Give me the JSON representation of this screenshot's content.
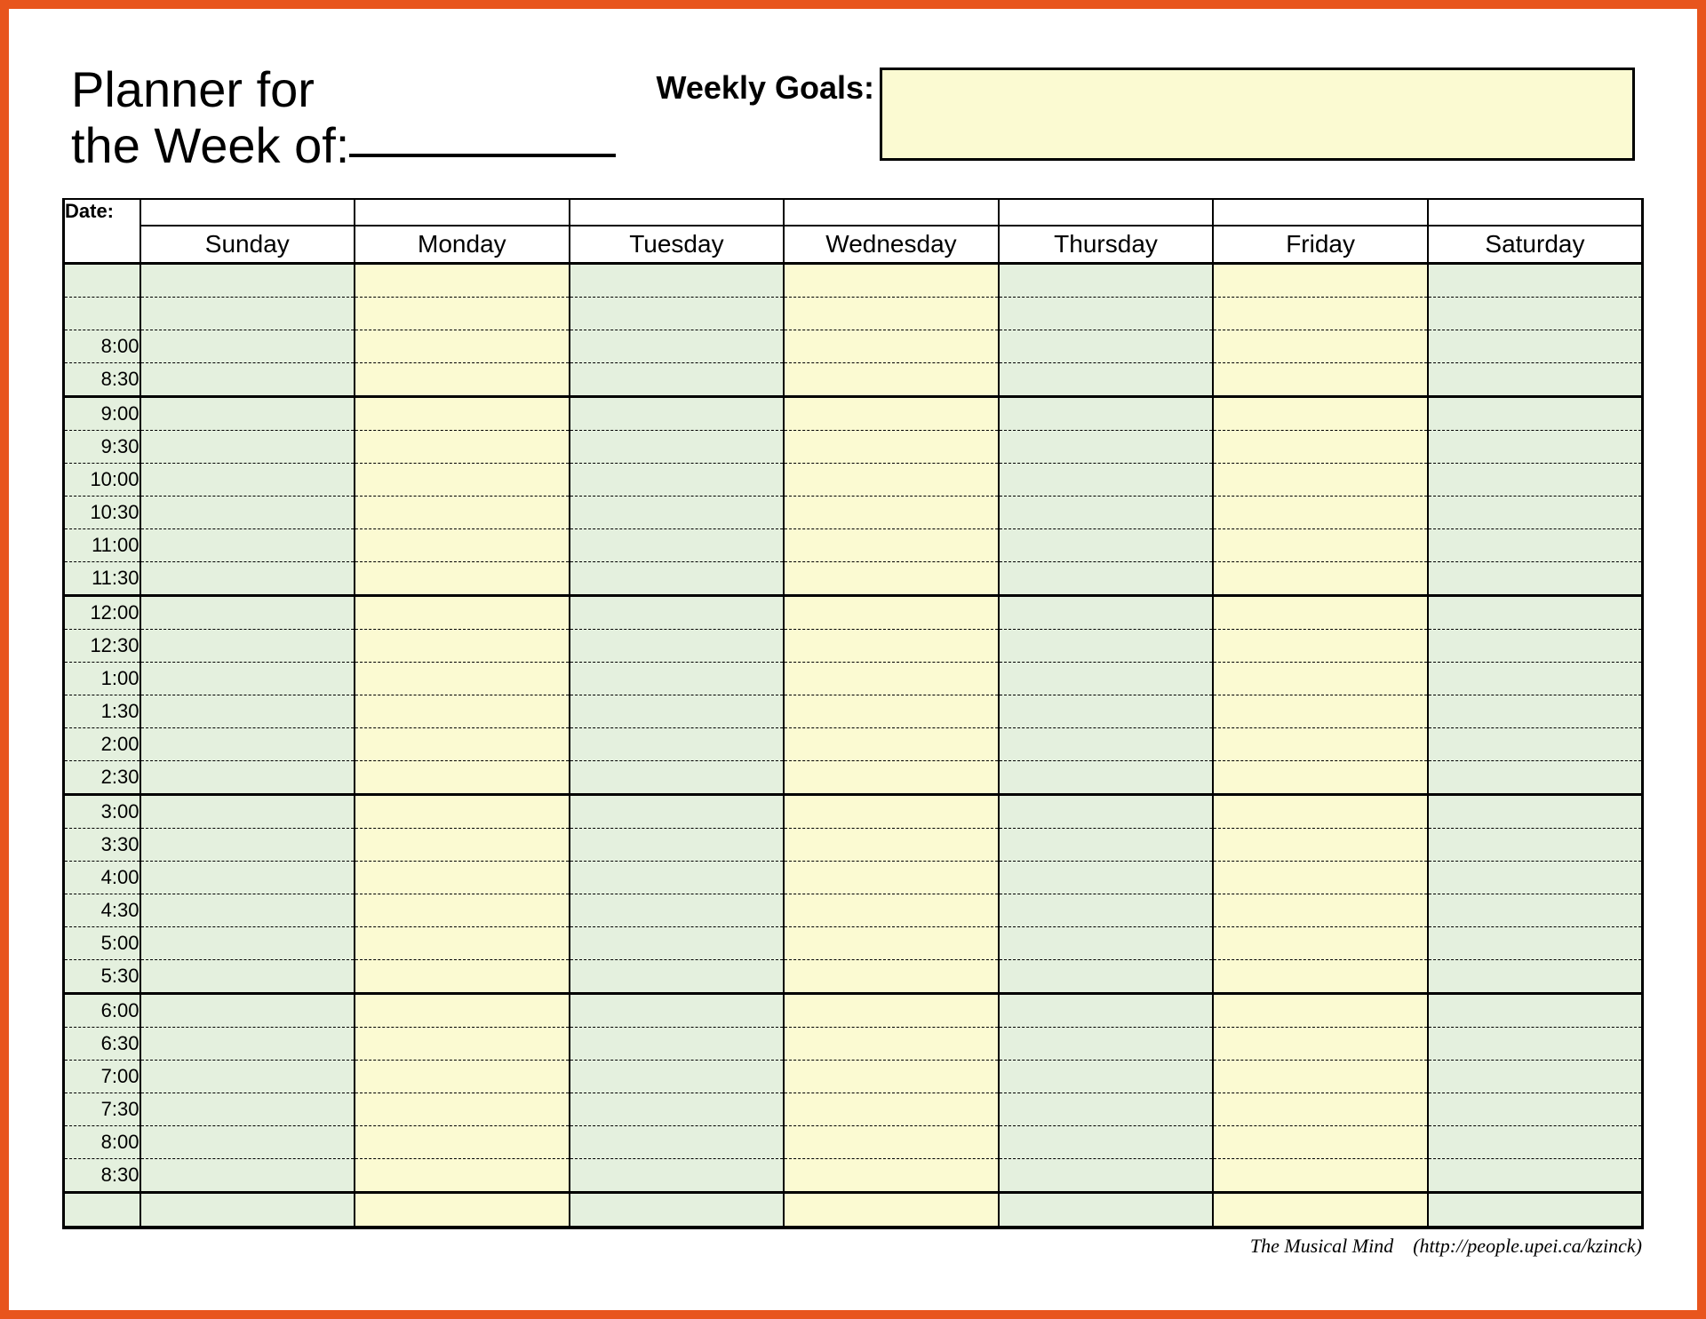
{
  "title_line1": "Planner for",
  "title_line2": "the Week of:",
  "goals_label": "Weekly Goals:",
  "header": {
    "date_label": "Date:",
    "days": [
      "Sunday",
      "Monday",
      "Tuesday",
      "Wednesday",
      "Thursday",
      "Friday",
      "Saturday"
    ]
  },
  "times": [
    {
      "label": "",
      "solid": true
    },
    {
      "label": "",
      "solid": false
    },
    {
      "label": "8:00",
      "solid": false
    },
    {
      "label": "8:30",
      "solid": false
    },
    {
      "label": "9:00",
      "solid": true
    },
    {
      "label": "9:30",
      "solid": false
    },
    {
      "label": "10:00",
      "solid": false
    },
    {
      "label": "10:30",
      "solid": false
    },
    {
      "label": "11:00",
      "solid": false
    },
    {
      "label": "11:30",
      "solid": false
    },
    {
      "label": "12:00",
      "solid": true
    },
    {
      "label": "12:30",
      "solid": false
    },
    {
      "label": "1:00",
      "solid": false
    },
    {
      "label": "1:30",
      "solid": false
    },
    {
      "label": "2:00",
      "solid": false
    },
    {
      "label": "2:30",
      "solid": false
    },
    {
      "label": "3:00",
      "solid": true
    },
    {
      "label": "3:30",
      "solid": false
    },
    {
      "label": "4:00",
      "solid": false
    },
    {
      "label": "4:30",
      "solid": false
    },
    {
      "label": "5:00",
      "solid": false
    },
    {
      "label": "5:30",
      "solid": false
    },
    {
      "label": "6:00",
      "solid": true
    },
    {
      "label": "6:30",
      "solid": false
    },
    {
      "label": "7:00",
      "solid": false
    },
    {
      "label": "7:30",
      "solid": false
    },
    {
      "label": "8:00",
      "solid": false
    },
    {
      "label": "8:30",
      "solid": false
    },
    {
      "label": "",
      "solid": true
    }
  ],
  "col_shades": [
    "green",
    "cream",
    "green",
    "cream",
    "green",
    "cream",
    "green"
  ],
  "footer_credit": "The Musical Mind",
  "footer_paren": "(http://people.upei.ca/kzinck)"
}
